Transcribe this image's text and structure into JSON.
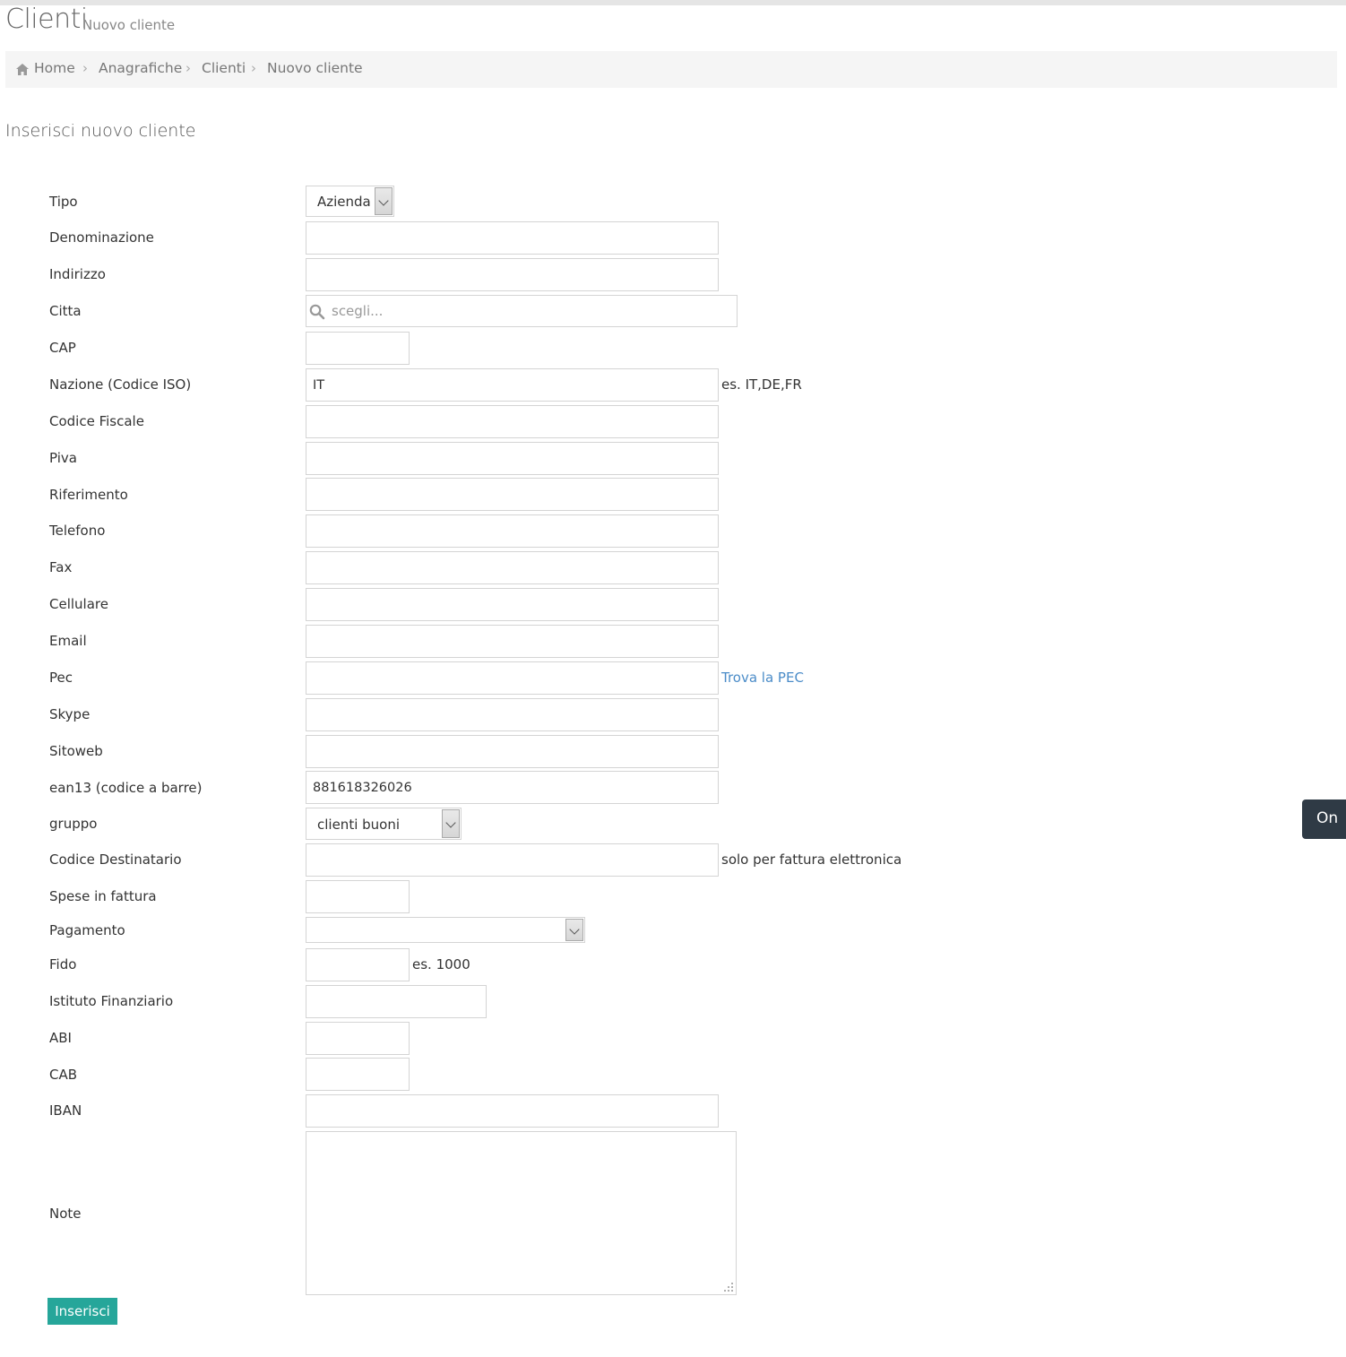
{
  "header": {
    "title": "Clienti",
    "subtitle": "Nuovo cliente"
  },
  "breadcrumb": {
    "items": [
      "Home",
      "Anagrafiche",
      "Clienti",
      "Nuovo cliente"
    ]
  },
  "form": {
    "section_title": "Inserisci nuovo cliente",
    "tipo": {
      "label": "Tipo",
      "value": "Azienda"
    },
    "denominazione": {
      "label": "Denominazione",
      "value": ""
    },
    "indirizzo": {
      "label": "Indirizzo",
      "value": ""
    },
    "citta": {
      "label": "Citta",
      "placeholder": "scegli..."
    },
    "cap": {
      "label": "CAP",
      "value": ""
    },
    "nazione": {
      "label": "Nazione (Codice ISO)",
      "value": "IT",
      "hint": "es. IT,DE,FR"
    },
    "codice_fiscale": {
      "label": "Codice Fiscale",
      "value": ""
    },
    "piva": {
      "label": "Piva",
      "value": ""
    },
    "riferimento": {
      "label": "Riferimento",
      "value": ""
    },
    "telefono": {
      "label": "Telefono",
      "value": ""
    },
    "fax": {
      "label": "Fax",
      "value": ""
    },
    "cellulare": {
      "label": "Cellulare",
      "value": ""
    },
    "email": {
      "label": "Email",
      "value": ""
    },
    "pec": {
      "label": "Pec",
      "value": "",
      "link": "Trova la PEC"
    },
    "skype": {
      "label": "Skype",
      "value": ""
    },
    "sitoweb": {
      "label": "Sitoweb",
      "value": ""
    },
    "ean13": {
      "label": "ean13 (codice a barre)",
      "value": "881618326026"
    },
    "gruppo": {
      "label": "gruppo",
      "value": "clienti buoni"
    },
    "codice_destinatario": {
      "label": "Codice Destinatario",
      "value": "",
      "hint": "solo per fattura elettronica"
    },
    "spese": {
      "label": "Spese in fattura",
      "value": ""
    },
    "pagamento": {
      "label": "Pagamento",
      "value": ""
    },
    "fido": {
      "label": "Fido",
      "value": "",
      "hint": "es. 1000"
    },
    "istituto": {
      "label": "Istituto Finanziario",
      "value": ""
    },
    "abi": {
      "label": "ABI",
      "value": ""
    },
    "cab": {
      "label": "CAB",
      "value": ""
    },
    "iban": {
      "label": "IBAN",
      "value": ""
    },
    "note": {
      "label": "Note",
      "value": ""
    },
    "submit_label": "Inserisci"
  },
  "side_tab": {
    "label": "On"
  },
  "colors": {
    "accent": "#26a69a",
    "link": "#4b8cc8",
    "side_tab_bg": "#2f3a45"
  }
}
